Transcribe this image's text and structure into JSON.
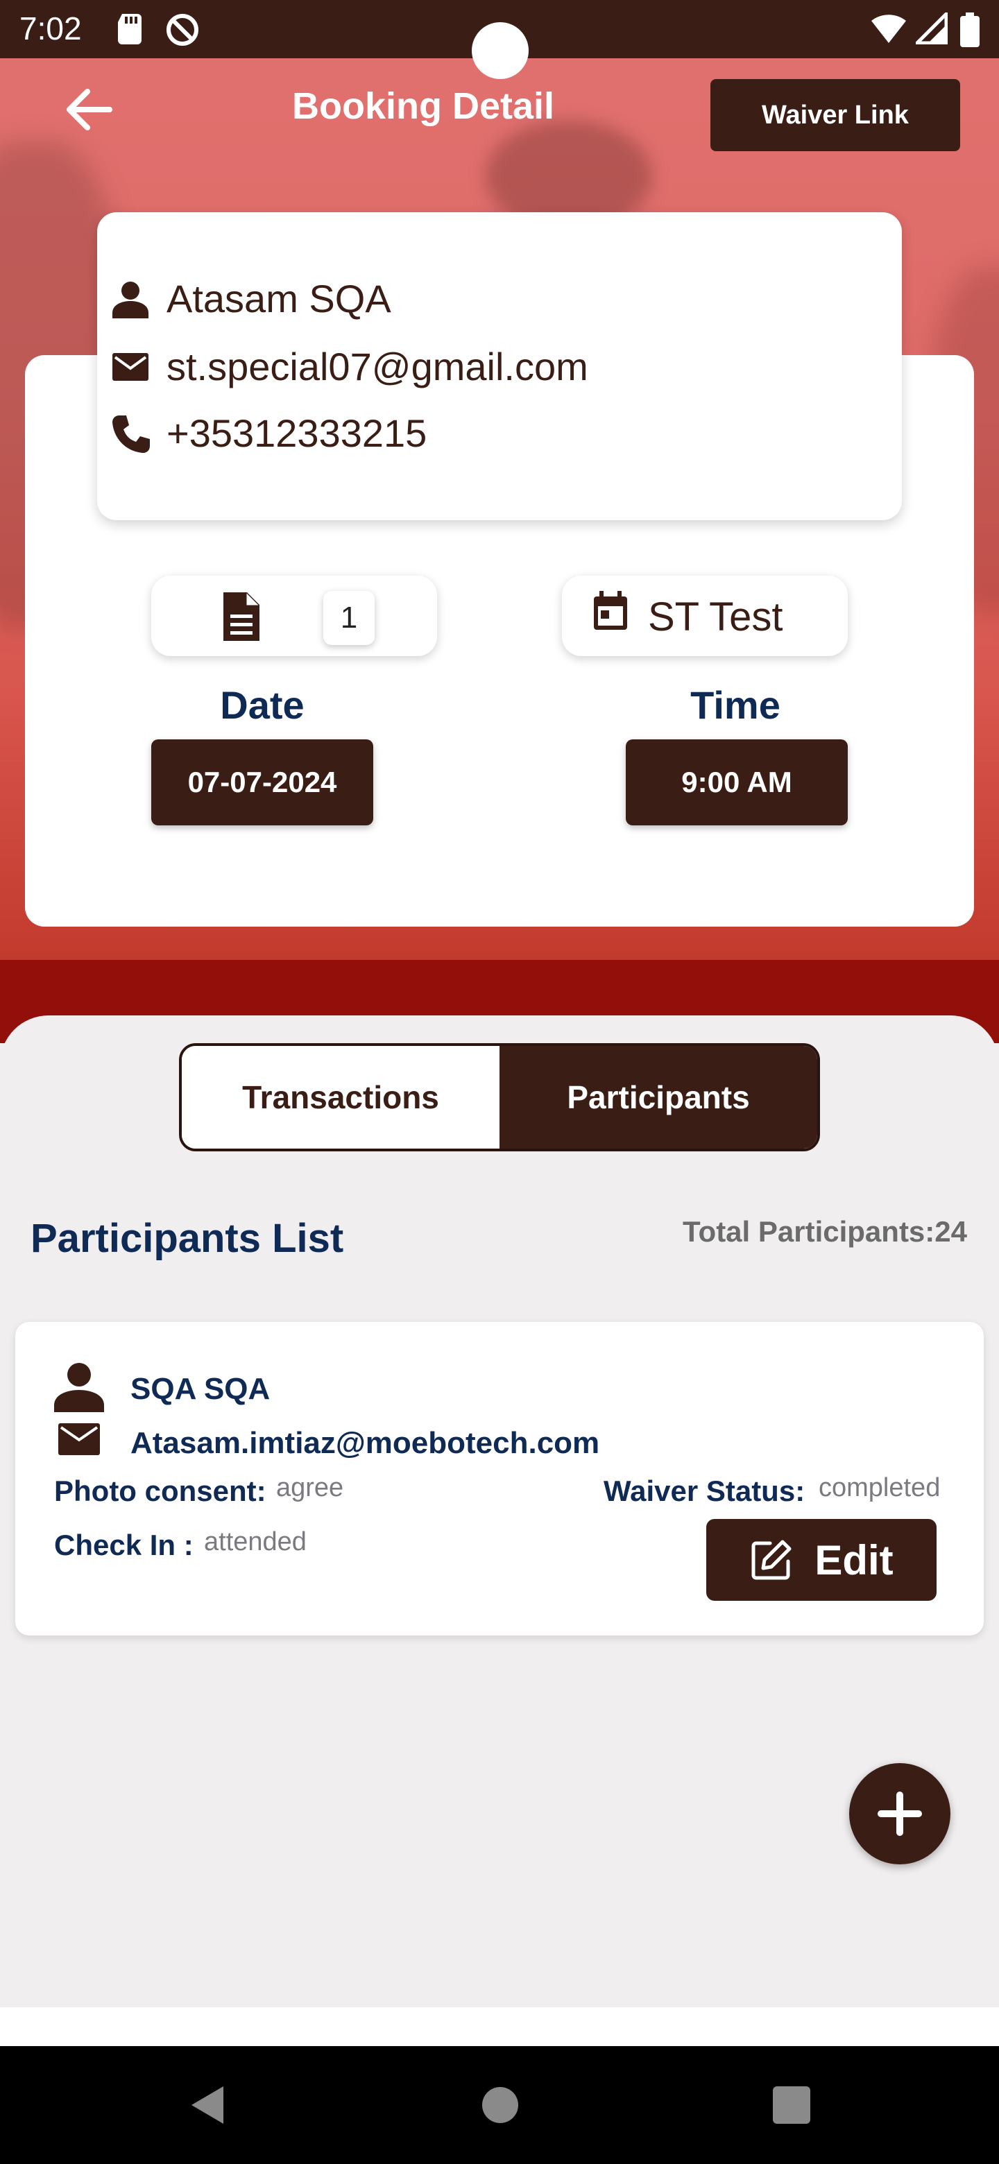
{
  "status_bar": {
    "time": "7:02",
    "icons": [
      "sd-card-icon",
      "do-not-disturb-icon",
      "wifi-icon",
      "signal-icon",
      "battery-icon"
    ]
  },
  "header": {
    "title": "Booking Detail",
    "waiver_link_label": "Waiver Link",
    "back_icon": "arrow-left-icon"
  },
  "contact": {
    "name": "Atasam SQA",
    "email": "st.special07@gmail.com",
    "phone": "+35312333215"
  },
  "booking": {
    "document_count": "1",
    "event_name": "ST Test",
    "date_label": "Date",
    "date_value": "07-07-2024",
    "time_label": "Time",
    "time_value": "9:00 AM"
  },
  "tabs": [
    {
      "label": "Transactions",
      "active": false
    },
    {
      "label": "Participants",
      "active": true
    }
  ],
  "participants": {
    "title": "Participants List",
    "total_text": "Total Participants:24",
    "items": [
      {
        "name": "SQA SQA",
        "email": "Atasam.imtiaz@moebotech.com",
        "photo_consent_label": "Photo consent:",
        "photo_consent_value": "agree",
        "waiver_status_label": "Waiver Status:",
        "waiver_status_value": "completed",
        "check_in_label": "Check In :",
        "check_in_value": "attended",
        "edit_label": "Edit"
      }
    ]
  },
  "colors": {
    "primary_dark": "#3a1e16",
    "navy_text": "#0f2a55",
    "hero_red": "#de6a66",
    "band_red": "#920f0a"
  }
}
